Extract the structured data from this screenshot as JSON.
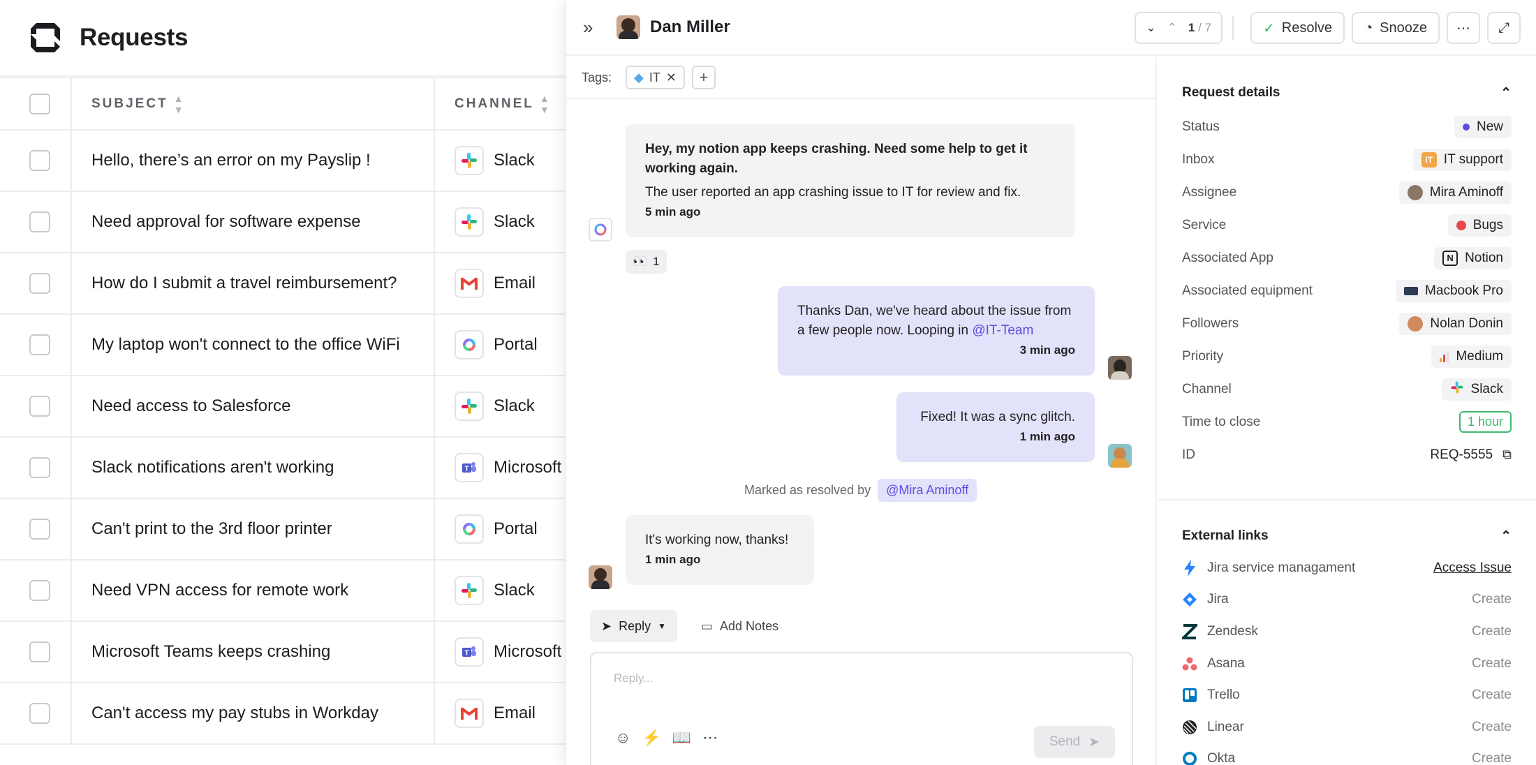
{
  "page": {
    "title": "Requests"
  },
  "table": {
    "columns": {
      "subject": "SUBJECT",
      "channel": "CHANNEL"
    },
    "rows": [
      {
        "subject": "Hello, there’s an error on my Payslip !",
        "channel": "Slack",
        "icon": "slack-icon"
      },
      {
        "subject": "Need approval for software expense",
        "channel": "Slack",
        "icon": "slack-icon"
      },
      {
        "subject": "How do I submit a travel reimbursement?",
        "channel": "Email",
        "icon": "gmail-icon"
      },
      {
        "subject": "My laptop won't connect to the office WiFi",
        "channel": "Portal",
        "icon": "portal-icon"
      },
      {
        "subject": "Need access to Salesforce",
        "channel": "Slack",
        "icon": "slack-icon"
      },
      {
        "subject": "Slack notifications aren't working",
        "channel": "Microsoft",
        "icon": "teams-icon"
      },
      {
        "subject": "Can't print to the 3rd floor printer",
        "channel": "Portal",
        "icon": "portal-icon"
      },
      {
        "subject": "Need VPN access for remote work",
        "channel": "Slack",
        "icon": "slack-icon"
      },
      {
        "subject": "Microsoft Teams keeps crashing",
        "channel": "Microsoft",
        "icon": "teams-icon"
      },
      {
        "subject": "Can't access my pay stubs in Workday",
        "channel": "Email",
        "icon": "gmail-icon"
      }
    ]
  },
  "panel": {
    "user_name": "Dan Miller",
    "pager": {
      "current": "1",
      "total": "/ 7"
    },
    "resolve": "Resolve",
    "snooze": "Snooze",
    "tags_label": "Tags:",
    "tag": "IT"
  },
  "conversation": {
    "m1": {
      "title": "Hey, my notion app keeps crashing. Need some help to get it working again.",
      "body": "The user reported an app crashing issue to IT for review and fix.",
      "time": "5 min ago"
    },
    "reaction": {
      "emoji": "👀",
      "count": "1"
    },
    "m2": {
      "text": "Thanks Dan, we've heard about the issue from a few people now. Looping in",
      "mention": "@IT-Team",
      "time": "3 min ago"
    },
    "m3": {
      "text": "Fixed! It was a sync glitch.",
      "time": "1 min ago"
    },
    "resolved": {
      "text": "Marked as resolved by",
      "by": "@Mira Aminoff"
    },
    "m4": {
      "text": "It's working now, thanks!",
      "time": "1 min ago"
    },
    "reply_tab": "Reply",
    "notes_tab": "Add Notes",
    "reply_placeholder": "Reply...",
    "send": "Send"
  },
  "details": {
    "title": "Request details",
    "rows": [
      {
        "label": "Status",
        "value": "New"
      },
      {
        "label": "Inbox",
        "value": "IT support"
      },
      {
        "label": "Assignee",
        "value": "Mira Aminoff"
      },
      {
        "label": "Service",
        "value": "Bugs"
      },
      {
        "label": "Associated App",
        "value": "Notion"
      },
      {
        "label": "Associated equipment",
        "value": "Macbook Pro"
      },
      {
        "label": "Followers",
        "value": "Nolan Donin"
      },
      {
        "label": "Priority",
        "value": "Medium"
      },
      {
        "label": "Channel",
        "value": "Slack"
      },
      {
        "label": "Time to close",
        "value": "1 hour"
      },
      {
        "label": "ID",
        "value": "REQ-5555"
      }
    ],
    "status_color": "#5b4fe0",
    "service_color": "#e5484d"
  },
  "links": {
    "title": "External links",
    "items": [
      {
        "name": "Jira service managament",
        "action": "Access Issue"
      },
      {
        "name": "Jira",
        "action": "Create"
      },
      {
        "name": "Zendesk",
        "action": "Create"
      },
      {
        "name": "Asana",
        "action": "Create"
      },
      {
        "name": "Trello",
        "action": "Create"
      },
      {
        "name": "Linear",
        "action": "Create"
      },
      {
        "name": "Okta",
        "action": "Create"
      }
    ]
  }
}
